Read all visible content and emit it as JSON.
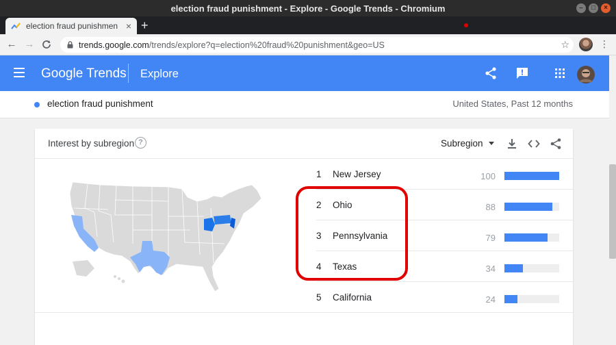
{
  "window": {
    "title": "election fraud punishment - Explore - Google Trends - Chromium"
  },
  "tab": {
    "title": "election fraud punishmen",
    "close": "×",
    "new_tab": "+"
  },
  "address": {
    "host": "trends.google.com",
    "path": "/trends/explore?q=election%20fraud%20punishment&geo=US"
  },
  "header": {
    "logo": "Google Trends",
    "page": "Explore"
  },
  "term": {
    "label": "election fraud punishment",
    "meta": "United States, Past 12 months"
  },
  "card": {
    "title": "Interest by subregion",
    "resolution": "Subregion",
    "rows": [
      {
        "rank": "1",
        "name": "New Jersey",
        "value": 100
      },
      {
        "rank": "2",
        "name": "Ohio",
        "value": 88
      },
      {
        "rank": "3",
        "name": "Pennsylvania",
        "value": 79
      },
      {
        "rank": "4",
        "name": "Texas",
        "value": 34
      },
      {
        "rank": "5",
        "name": "California",
        "value": 24
      }
    ]
  },
  "colors": {
    "brand": "#4285f4",
    "highlight": "#e00000",
    "bar_track": "#eeeeee"
  }
}
